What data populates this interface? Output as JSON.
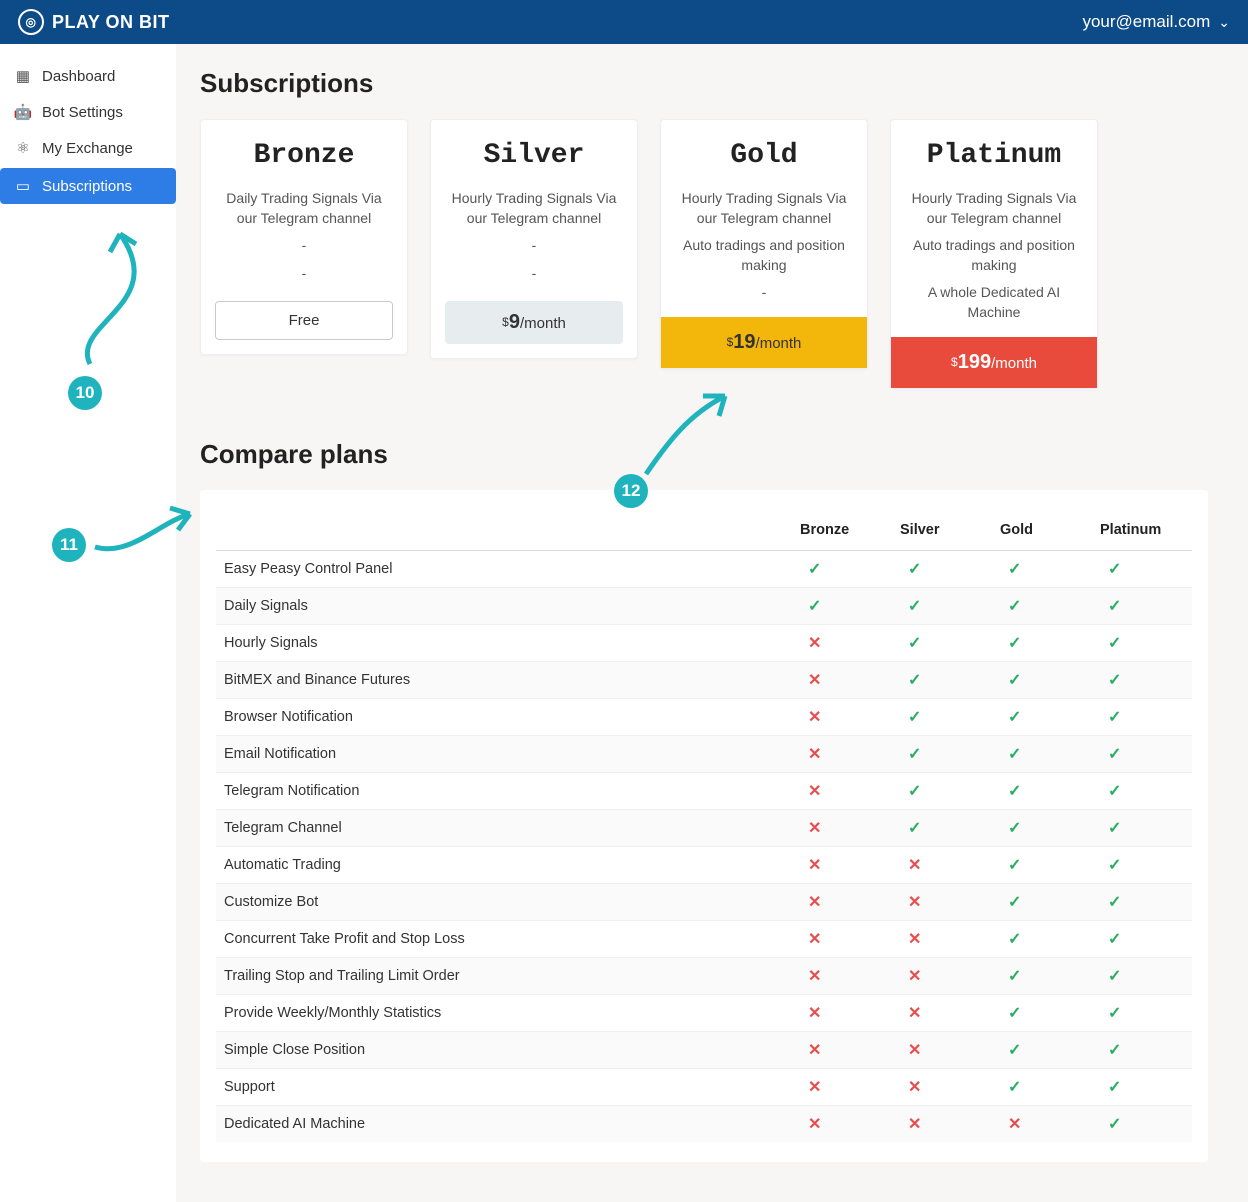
{
  "header": {
    "brand": "PLAY ON BIT",
    "user_email": "your@email.com"
  },
  "sidebar": {
    "items": [
      {
        "label": "Dashboard",
        "icon": "grid-icon",
        "active": false
      },
      {
        "label": "Bot Settings",
        "icon": "robot-icon",
        "active": false
      },
      {
        "label": "My Exchange",
        "icon": "atom-icon",
        "active": false
      },
      {
        "label": "Subscriptions",
        "icon": "card-icon",
        "active": true
      }
    ]
  },
  "page": {
    "title_subscriptions": "Subscriptions",
    "title_compare": "Compare plans"
  },
  "plans": [
    {
      "name": "Bronze",
      "features": [
        "Daily Trading Signals Via our Telegram channel",
        "-",
        "-"
      ],
      "price_label": "Free",
      "price_amount": "",
      "btn_class": "btn-free"
    },
    {
      "name": "Silver",
      "features": [
        "Hourly Trading Signals Via our Telegram channel",
        "-",
        "-"
      ],
      "price_label": "/month",
      "price_amount": "9",
      "btn_class": "btn-silver"
    },
    {
      "name": "Gold",
      "features": [
        "Hourly Trading Signals Via our Telegram channel",
        "Auto tradings and position making",
        "-"
      ],
      "price_label": "/month",
      "price_amount": "19",
      "btn_class": "btn-gold"
    },
    {
      "name": "Platinum",
      "features": [
        "Hourly Trading Signals Via our Telegram channel",
        "Auto tradings and position making",
        "A whole Dedicated AI Machine"
      ],
      "price_label": "/month",
      "price_amount": "199",
      "btn_class": "btn-plat"
    }
  ],
  "compare": {
    "columns": [
      "",
      "Bronze",
      "Silver",
      "Gold",
      "Platinum"
    ],
    "rows": [
      {
        "feature": "Easy Peasy Control Panel",
        "cells": [
          "y",
          "y",
          "y",
          "y"
        ]
      },
      {
        "feature": "Daily Signals",
        "cells": [
          "y",
          "y",
          "y",
          "y"
        ]
      },
      {
        "feature": "Hourly Signals",
        "cells": [
          "n",
          "y",
          "y",
          "y"
        ]
      },
      {
        "feature": "BitMEX and Binance Futures",
        "cells": [
          "n",
          "y",
          "y",
          "y"
        ]
      },
      {
        "feature": "Browser Notification",
        "cells": [
          "n",
          "y",
          "y",
          "y"
        ]
      },
      {
        "feature": "Email Notification",
        "cells": [
          "n",
          "y",
          "y",
          "y"
        ]
      },
      {
        "feature": "Telegram Notification",
        "cells": [
          "n",
          "y",
          "y",
          "y"
        ]
      },
      {
        "feature": "Telegram Channel",
        "cells": [
          "n",
          "y",
          "y",
          "y"
        ]
      },
      {
        "feature": "Automatic Trading",
        "cells": [
          "n",
          "n",
          "y",
          "y"
        ]
      },
      {
        "feature": "Customize Bot",
        "cells": [
          "n",
          "n",
          "y",
          "y"
        ]
      },
      {
        "feature": "Concurrent Take Profit and Stop Loss",
        "cells": [
          "n",
          "n",
          "y",
          "y"
        ]
      },
      {
        "feature": "Trailing Stop and Trailing Limit Order",
        "cells": [
          "n",
          "n",
          "y",
          "y"
        ]
      },
      {
        "feature": "Provide Weekly/Monthly Statistics",
        "cells": [
          "n",
          "n",
          "y",
          "y"
        ]
      },
      {
        "feature": "Simple Close Position",
        "cells": [
          "n",
          "n",
          "y",
          "y"
        ]
      },
      {
        "feature": "Support",
        "cells": [
          "n",
          "n",
          "y",
          "y"
        ]
      },
      {
        "feature": "Dedicated AI Machine",
        "cells": [
          "n",
          "n",
          "n",
          "y"
        ]
      }
    ]
  },
  "annotations": {
    "c10": "10",
    "c11": "11",
    "c12": "12"
  }
}
